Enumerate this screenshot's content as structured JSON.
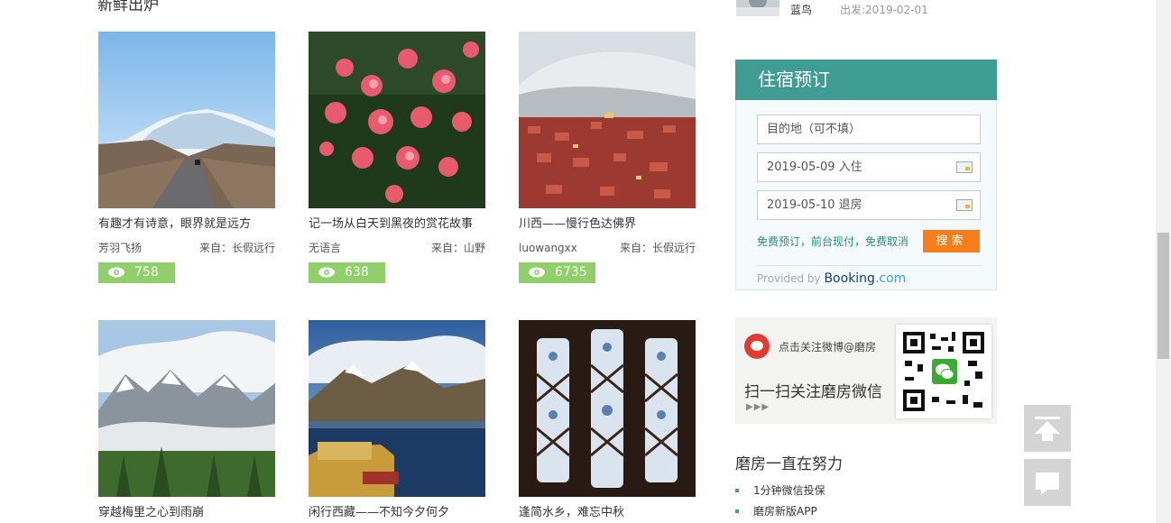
{
  "section": {
    "title": "新鲜出炉"
  },
  "cards": [
    {
      "title": "有趣才有诗意，眼界就是远方",
      "author": "芳羽飞扬",
      "source": "来自：长假远行",
      "views": "758"
    },
    {
      "title": "记一场从白天到黑夜的赏花故事",
      "author": "无语言",
      "source": "来自：山野",
      "views": "638"
    },
    {
      "title": "川西——慢行色达佛界",
      "author": "luowangxx",
      "source": "来自：长假远行",
      "views": "6735"
    },
    {
      "title": "穿越梅里之心到雨崩"
    },
    {
      "title": "闲行西藏——不知今夕何夕"
    },
    {
      "title": "逢简水乡，难忘中秋"
    }
  ],
  "sidebar_user": {
    "name": "蓝鸟",
    "depart": "出发:2019-02-01"
  },
  "booking": {
    "title": "住宿预订",
    "destination_placeholder": "目的地（可不填）",
    "checkin": "2019-05-09 入住",
    "checkout": "2019-05-10 退房",
    "free_text": "免费预订，前台现付，免费取消",
    "search_label": "搜索",
    "provided_by": "Provided by",
    "brand_main": "Booking",
    "brand_suffix": ".com"
  },
  "follow": {
    "weibo_text": "点击关注微博@磨房",
    "wechat_text": "扫一扫关注磨房微信",
    "arrows": "▶▶▶"
  },
  "efforts": {
    "title": "磨房一直在努力",
    "items": [
      "1分钟微信投保",
      "磨房新版APP"
    ]
  },
  "icons": {
    "views": "eye-icon",
    "top": "arrow-up-icon",
    "comment": "comment-icon",
    "calendar": "calendar-icon",
    "weibo": "weibo-icon",
    "wechat": "wechat-icon"
  },
  "colors": {
    "teal": "#3f9d94",
    "orange": "#f77d1b",
    "green": "#8fd06a"
  }
}
